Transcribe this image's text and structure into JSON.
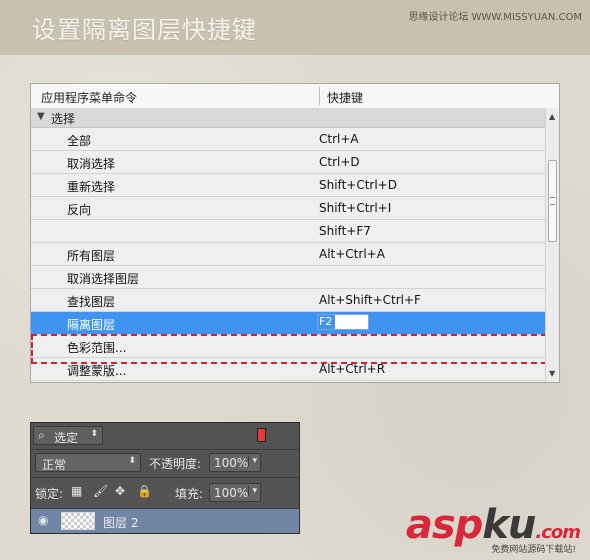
{
  "header": {
    "title": "设置隔离图层快捷键",
    "site": "思缘设计论坛 WWW.MISSYUAN.COM"
  },
  "shortcuts": {
    "col_command": "应用程序菜单命令",
    "col_shortcut": "快捷键",
    "group": "选择",
    "rows": [
      {
        "name": "全部",
        "key": "Ctrl+A"
      },
      {
        "name": "取消选择",
        "key": "Ctrl+D"
      },
      {
        "name": "重新选择",
        "key": "Shift+Ctrl+D"
      },
      {
        "name": "反向",
        "key": "Shift+Ctrl+I"
      },
      {
        "name": "",
        "key": "Shift+F7"
      },
      {
        "name": "所有图层",
        "key": "Alt+Ctrl+A"
      },
      {
        "name": "取消选择图层",
        "key": ""
      },
      {
        "name": "查找图层",
        "key": "Alt+Shift+Ctrl+F"
      },
      {
        "name": "隔离图层",
        "key": "F2",
        "selected": true
      },
      {
        "name": "色彩范围...",
        "key": ""
      },
      {
        "name": "调整蒙版...",
        "key": "Alt+Ctrl+R"
      }
    ]
  },
  "layers": {
    "filter_label": "选定",
    "filter_icon": "search-icon",
    "blend_mode": "正常",
    "opacity_label": "不透明度:",
    "opacity_value": "100%",
    "lock_label": "锁定:",
    "fill_label": "填充:",
    "fill_value": "100%",
    "layer_name": "图层 2"
  },
  "watermark": {
    "logo_a": "asp",
    "logo_b": "ku",
    "logo_c": ".com",
    "sub": "免费网站源码下载站!"
  }
}
